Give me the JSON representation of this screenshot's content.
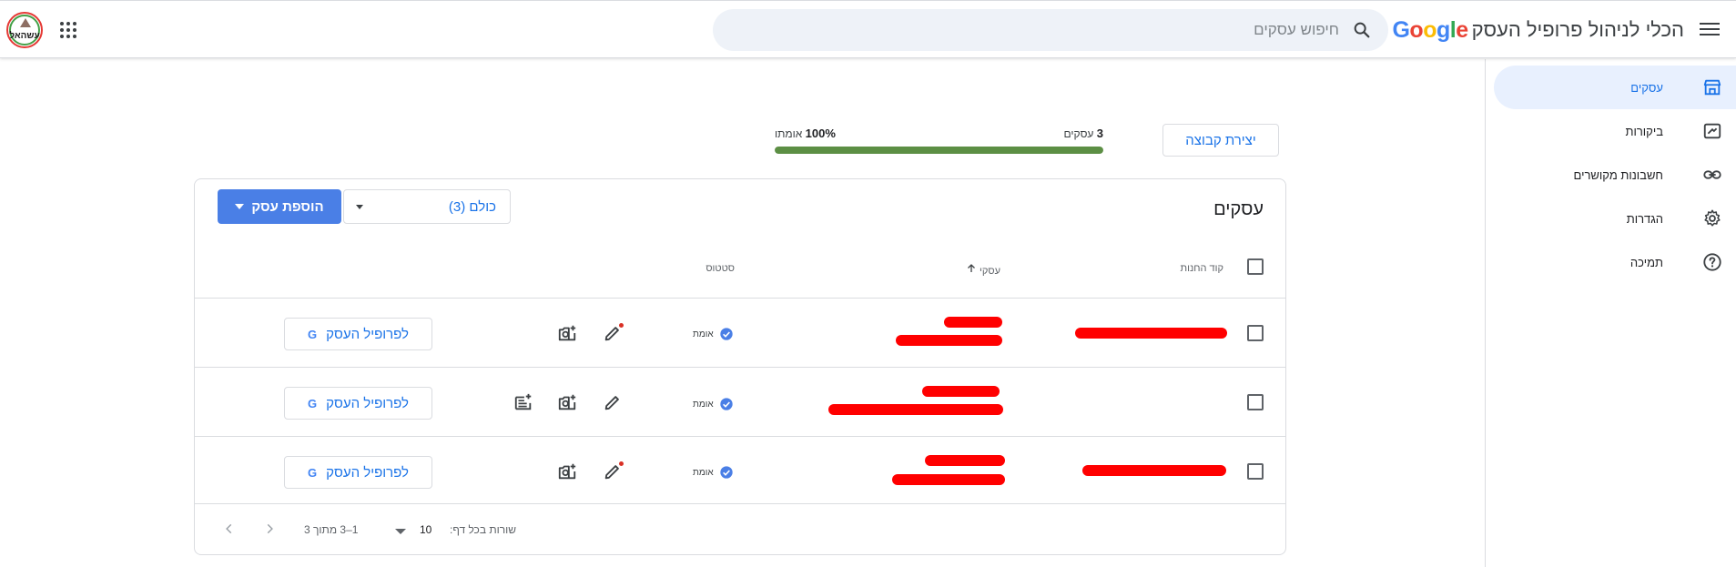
{
  "header": {
    "google_logo": "Google",
    "product_name": "הכלי לניהול פרופיל העסק",
    "search_placeholder": "חיפוש עסקים"
  },
  "account": {
    "avatar_text": "עשהאל"
  },
  "sidebar": {
    "items": [
      {
        "label": "עסקים",
        "icon": "storefront-icon",
        "active": true
      },
      {
        "label": "ביקורות",
        "icon": "reviews-icon",
        "active": false
      },
      {
        "label": "חשבונות מקושרים",
        "icon": "link-icon",
        "active": false
      },
      {
        "label": "הגדרות",
        "icon": "gear-icon",
        "active": false
      },
      {
        "label": "תמיכה",
        "icon": "help-icon",
        "active": false
      }
    ]
  },
  "summary": {
    "create_group_label": "יצירת קבוצה",
    "business_count": "3",
    "business_count_suffix": "עסקים",
    "verified_percent": "100%",
    "verified_suffix": "אומתו",
    "verified_fraction": 1.0,
    "bar_color": "#5c8f44"
  },
  "card": {
    "title": "עסקים",
    "filter_label": "כולם (3)",
    "add_business_label": "הוספת עסק",
    "columns": {
      "store_code": "קוד החנות",
      "business": "עסקי",
      "status": "סטטוס"
    },
    "rows": [
      {
        "status": "אומת",
        "profile_button": "לפרופיל העסק",
        "has_post_icon": false,
        "edit_has_dot": true
      },
      {
        "status": "אומת",
        "profile_button": "לפרופיל העסק",
        "has_post_icon": true,
        "edit_has_dot": false
      },
      {
        "status": "אומת",
        "profile_button": "לפרופיל העסק",
        "has_post_icon": false,
        "edit_has_dot": true
      }
    ]
  },
  "footer": {
    "rows_per_page_label": "שורות בכל דף:",
    "rows_per_page_value": "10",
    "range_text": "1–3 מתוך 3"
  },
  "colors": {
    "accent": "#1a73e8",
    "primary_button": "#4a7fe6",
    "redaction": "#ff0000",
    "verified_badge": "#4a7fe6"
  }
}
